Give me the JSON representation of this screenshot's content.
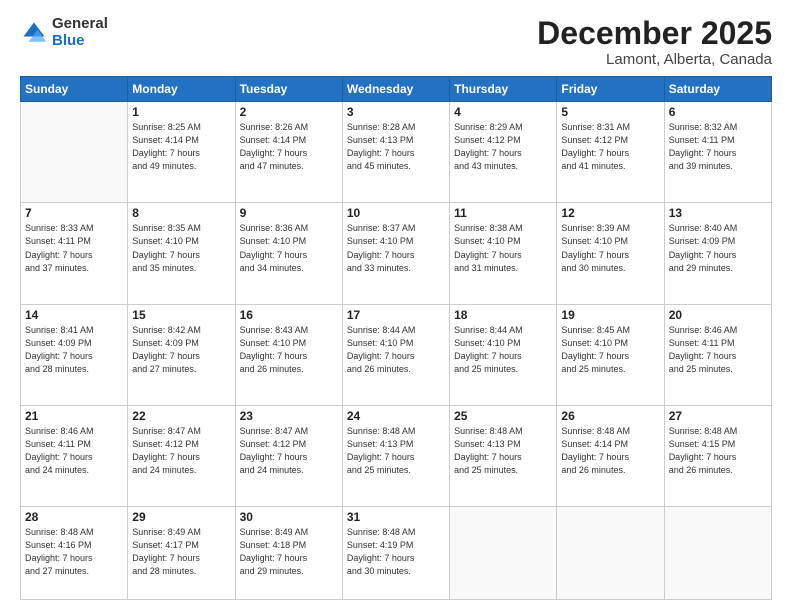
{
  "logo": {
    "general": "General",
    "blue": "Blue"
  },
  "header": {
    "month": "December 2025",
    "location": "Lamont, Alberta, Canada"
  },
  "weekdays": [
    "Sunday",
    "Monday",
    "Tuesday",
    "Wednesday",
    "Thursday",
    "Friday",
    "Saturday"
  ],
  "weeks": [
    [
      {
        "day": "",
        "info": ""
      },
      {
        "day": "1",
        "info": "Sunrise: 8:25 AM\nSunset: 4:14 PM\nDaylight: 7 hours\nand 49 minutes."
      },
      {
        "day": "2",
        "info": "Sunrise: 8:26 AM\nSunset: 4:14 PM\nDaylight: 7 hours\nand 47 minutes."
      },
      {
        "day": "3",
        "info": "Sunrise: 8:28 AM\nSunset: 4:13 PM\nDaylight: 7 hours\nand 45 minutes."
      },
      {
        "day": "4",
        "info": "Sunrise: 8:29 AM\nSunset: 4:12 PM\nDaylight: 7 hours\nand 43 minutes."
      },
      {
        "day": "5",
        "info": "Sunrise: 8:31 AM\nSunset: 4:12 PM\nDaylight: 7 hours\nand 41 minutes."
      },
      {
        "day": "6",
        "info": "Sunrise: 8:32 AM\nSunset: 4:11 PM\nDaylight: 7 hours\nand 39 minutes."
      }
    ],
    [
      {
        "day": "7",
        "info": "Sunrise: 8:33 AM\nSunset: 4:11 PM\nDaylight: 7 hours\nand 37 minutes."
      },
      {
        "day": "8",
        "info": "Sunrise: 8:35 AM\nSunset: 4:10 PM\nDaylight: 7 hours\nand 35 minutes."
      },
      {
        "day": "9",
        "info": "Sunrise: 8:36 AM\nSunset: 4:10 PM\nDaylight: 7 hours\nand 34 minutes."
      },
      {
        "day": "10",
        "info": "Sunrise: 8:37 AM\nSunset: 4:10 PM\nDaylight: 7 hours\nand 33 minutes."
      },
      {
        "day": "11",
        "info": "Sunrise: 8:38 AM\nSunset: 4:10 PM\nDaylight: 7 hours\nand 31 minutes."
      },
      {
        "day": "12",
        "info": "Sunrise: 8:39 AM\nSunset: 4:10 PM\nDaylight: 7 hours\nand 30 minutes."
      },
      {
        "day": "13",
        "info": "Sunrise: 8:40 AM\nSunset: 4:09 PM\nDaylight: 7 hours\nand 29 minutes."
      }
    ],
    [
      {
        "day": "14",
        "info": "Sunrise: 8:41 AM\nSunset: 4:09 PM\nDaylight: 7 hours\nand 28 minutes."
      },
      {
        "day": "15",
        "info": "Sunrise: 8:42 AM\nSunset: 4:09 PM\nDaylight: 7 hours\nand 27 minutes."
      },
      {
        "day": "16",
        "info": "Sunrise: 8:43 AM\nSunset: 4:10 PM\nDaylight: 7 hours\nand 26 minutes."
      },
      {
        "day": "17",
        "info": "Sunrise: 8:44 AM\nSunset: 4:10 PM\nDaylight: 7 hours\nand 26 minutes."
      },
      {
        "day": "18",
        "info": "Sunrise: 8:44 AM\nSunset: 4:10 PM\nDaylight: 7 hours\nand 25 minutes."
      },
      {
        "day": "19",
        "info": "Sunrise: 8:45 AM\nSunset: 4:10 PM\nDaylight: 7 hours\nand 25 minutes."
      },
      {
        "day": "20",
        "info": "Sunrise: 8:46 AM\nSunset: 4:11 PM\nDaylight: 7 hours\nand 25 minutes."
      }
    ],
    [
      {
        "day": "21",
        "info": "Sunrise: 8:46 AM\nSunset: 4:11 PM\nDaylight: 7 hours\nand 24 minutes."
      },
      {
        "day": "22",
        "info": "Sunrise: 8:47 AM\nSunset: 4:12 PM\nDaylight: 7 hours\nand 24 minutes."
      },
      {
        "day": "23",
        "info": "Sunrise: 8:47 AM\nSunset: 4:12 PM\nDaylight: 7 hours\nand 24 minutes."
      },
      {
        "day": "24",
        "info": "Sunrise: 8:48 AM\nSunset: 4:13 PM\nDaylight: 7 hours\nand 25 minutes."
      },
      {
        "day": "25",
        "info": "Sunrise: 8:48 AM\nSunset: 4:13 PM\nDaylight: 7 hours\nand 25 minutes."
      },
      {
        "day": "26",
        "info": "Sunrise: 8:48 AM\nSunset: 4:14 PM\nDaylight: 7 hours\nand 26 minutes."
      },
      {
        "day": "27",
        "info": "Sunrise: 8:48 AM\nSunset: 4:15 PM\nDaylight: 7 hours\nand 26 minutes."
      }
    ],
    [
      {
        "day": "28",
        "info": "Sunrise: 8:48 AM\nSunset: 4:16 PM\nDaylight: 7 hours\nand 27 minutes."
      },
      {
        "day": "29",
        "info": "Sunrise: 8:49 AM\nSunset: 4:17 PM\nDaylight: 7 hours\nand 28 minutes."
      },
      {
        "day": "30",
        "info": "Sunrise: 8:49 AM\nSunset: 4:18 PM\nDaylight: 7 hours\nand 29 minutes."
      },
      {
        "day": "31",
        "info": "Sunrise: 8:48 AM\nSunset: 4:19 PM\nDaylight: 7 hours\nand 30 minutes."
      },
      {
        "day": "",
        "info": ""
      },
      {
        "day": "",
        "info": ""
      },
      {
        "day": "",
        "info": ""
      }
    ]
  ]
}
